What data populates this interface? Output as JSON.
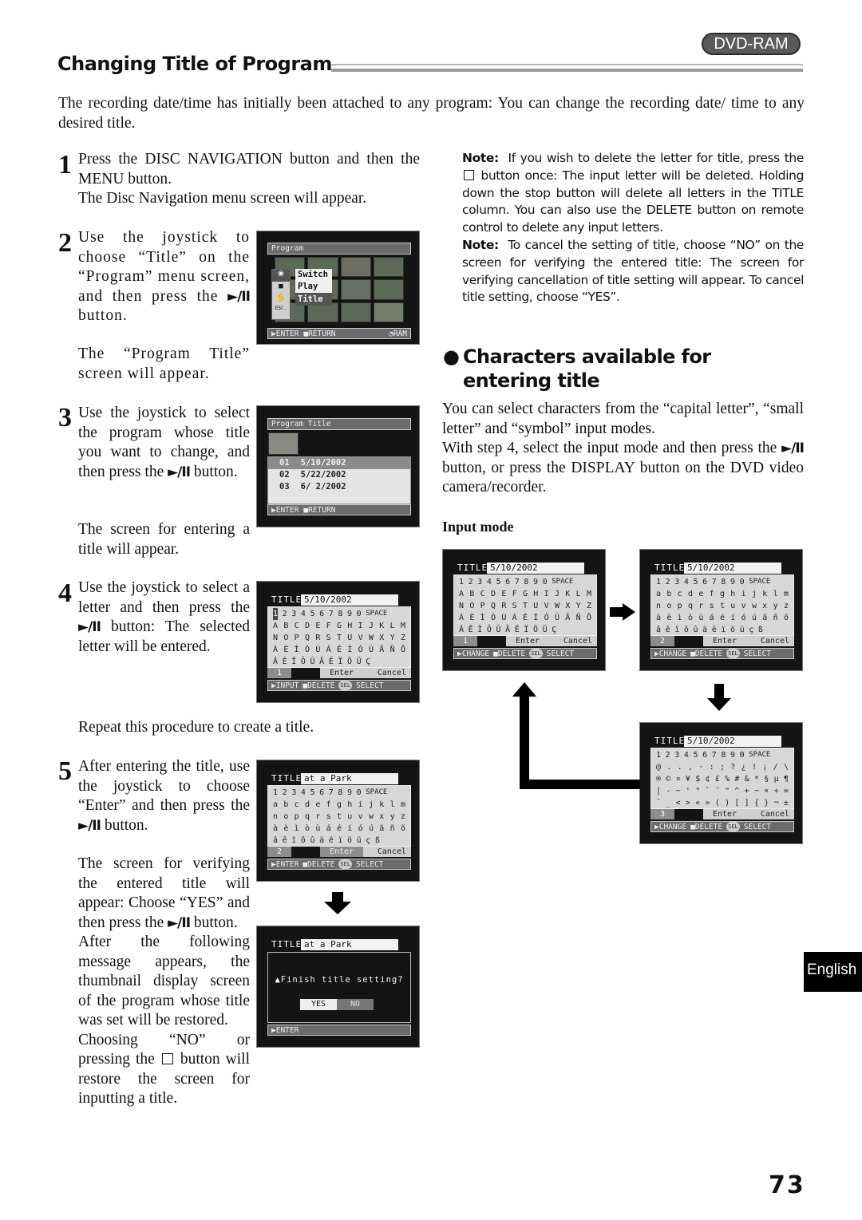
{
  "header": {
    "badge": "DVD-RAM",
    "section_title": "Changing Title of Program"
  },
  "intro": "The recording date/time has initially been attached to any program: You can change the recording date/ time to any desired title.",
  "icons": {
    "play_pause": "►/II",
    "stop_square": "□"
  },
  "steps": [
    {
      "num": "1",
      "text": "Press the DISC NAVIGATION button and then the MENU button.",
      "result": "The Disc Navigation menu screen will appear."
    },
    {
      "num": "2",
      "text_a": "Use the joystick to choose “Title” on the “Program” menu screen, and then press the",
      "text_b": "button.",
      "result": "The “Program Title” screen will appear."
    },
    {
      "num": "3",
      "text_a": "Use the joystick to select the program whose title you want to change, and then press the",
      "text_b": "button.",
      "result": "The screen for entering a title will appear."
    },
    {
      "num": "4",
      "text_a": "Use the joystick to select a letter and then press the",
      "text_b": "button: The selected letter will be entered.",
      "result": "Repeat this procedure to create a title."
    },
    {
      "num": "5",
      "text_a": "After entering the title, use the joystick to choose “Enter” and then press the",
      "text_b": "button.",
      "result_a": "The screen for verifying the entered title will appear: Choose “YES” and then press the",
      "result_b": "button.",
      "result2": "After the following message appears, the thumbnail display screen of the program whose title was set will be restored.",
      "result3_a": "Choosing “NO” or pressing the",
      "result3_b": "button will restore the screen for inputting a title."
    }
  ],
  "screens": {
    "program_menu": {
      "header": "Program",
      "menu_items": [
        "Switch",
        "Play",
        "Title"
      ],
      "selected": "Title",
      "side_icon_label": "ESC.",
      "footer_enter": "ENTER",
      "footer_return": "RETURN",
      "footer_media": "RAM"
    },
    "program_title": {
      "header": "Program Title",
      "rows": [
        {
          "no": "01",
          "date": "5/10/2002",
          "selected": true
        },
        {
          "no": "02",
          "date": "5/22/2002",
          "selected": false
        },
        {
          "no": "03",
          "date": "6/ 2/2002",
          "selected": false
        }
      ],
      "footer_enter": "ENTER",
      "footer_return": "RETURN"
    },
    "title_entry": {
      "label": "TITLE",
      "value": "5/10/2002",
      "mode_number": "1",
      "enter": "Enter",
      "cancel": "Cancel",
      "footer_a": "INPUT",
      "footer_b": "DELETE",
      "footer_sel": "SEL",
      "footer_c": "SELECT"
    },
    "title_enter_small": {
      "label": "TITLE",
      "value": "at a Park",
      "mode_number": "2",
      "enter": "Enter",
      "cancel": "Cancel",
      "footer_a": "ENTER",
      "footer_b": "DELETE",
      "footer_sel": "SEL",
      "footer_c": "SELECT"
    },
    "confirm": {
      "label": "TITLE",
      "value": "at a Park",
      "message": "Finish title setting?",
      "yes": "YES",
      "no": "NO",
      "footer": "ENTER"
    },
    "mode_footer": {
      "a": "CHANGE",
      "b": "DELETE",
      "sel": "SEL",
      "c": "SELECT"
    },
    "mode_title_value": "5/10/2002"
  },
  "char_sets": {
    "capital": [
      [
        "1",
        "2",
        "3",
        "4",
        "5",
        "6",
        "7",
        "8",
        "9",
        "0",
        "SPACE"
      ],
      [
        "A",
        "B",
        "C",
        "D",
        "E",
        "F",
        "G",
        "H",
        "I",
        "J",
        "K",
        "L",
        "M"
      ],
      [
        "N",
        "O",
        "P",
        "Q",
        "R",
        "S",
        "T",
        "U",
        "V",
        "W",
        "X",
        "Y",
        "Z"
      ],
      [
        "À",
        "È",
        "Ì",
        "Ò",
        "Ù",
        "Á",
        "É",
        "Í",
        "Ó",
        "Ú",
        "Ã",
        "Ñ",
        "Õ"
      ],
      [
        "Â",
        "Ê",
        "Î",
        "Ô",
        "Û",
        "Ä",
        "Ë",
        "Ï",
        "Ö",
        "Ü",
        "Ç"
      ]
    ],
    "small": [
      [
        "1",
        "2",
        "3",
        "4",
        "5",
        "6",
        "7",
        "8",
        "9",
        "0",
        "SPACE"
      ],
      [
        "a",
        "b",
        "c",
        "d",
        "e",
        "f",
        "g",
        "h",
        "i",
        "j",
        "k",
        "l",
        "m"
      ],
      [
        "n",
        "o",
        "p",
        "q",
        "r",
        "s",
        "t",
        "u",
        "v",
        "w",
        "x",
        "y",
        "z"
      ],
      [
        "à",
        "è",
        "ì",
        "ò",
        "ù",
        "á",
        "é",
        "í",
        "ó",
        "ú",
        "ã",
        "ñ",
        "õ"
      ],
      [
        "â",
        "ê",
        "î",
        "ô",
        "û",
        "ä",
        "ë",
        "ï",
        "ö",
        "ü",
        "ç",
        "ß"
      ]
    ],
    "symbol": [
      [
        "1",
        "2",
        "3",
        "4",
        "5",
        "6",
        "7",
        "8",
        "9",
        "0",
        "SPACE"
      ],
      [
        "@",
        ".",
        ".",
        ",",
        "·",
        ":",
        ";",
        "?",
        "¿",
        "!",
        "¡",
        "/",
        "\\"
      ],
      [
        "®",
        "©",
        "¤",
        "¥",
        "$",
        "¢",
        "£",
        "%",
        "#",
        "&",
        "*",
        "§",
        "µ",
        "¶"
      ],
      [
        "|",
        "-",
        "~",
        "'",
        "\"",
        "`",
        "´",
        "\"",
        "^",
        "+",
        "−",
        "×",
        "÷",
        "="
      ],
      [
        "¯",
        "_",
        "<",
        ">",
        "«",
        "»",
        "(",
        ")",
        "[",
        "]",
        "{",
        "}",
        "¬",
        "±"
      ]
    ]
  },
  "modes": [
    {
      "name": "capital letter",
      "number": "1"
    },
    {
      "name": "small letter",
      "number": "2"
    },
    {
      "name": "symbol",
      "number": "3"
    }
  ],
  "notes": [
    {
      "label": "Note:",
      "text_a": "If you wish to delete the letter for title, press the",
      "text_b": "button once: The input letter will be deleted. Holding down the stop button will delete all letters in the TITLE column. You can also use the DELETE button on remote control to delete any input letters."
    },
    {
      "label": "Note:",
      "text": "To cancel the setting of title, choose “NO” on the screen for verifying the entered title: The screen for verifying cancellation of title setting will appear. To cancel title setting, choose “YES”."
    }
  ],
  "chars_section": {
    "heading": "Characters available for entering title",
    "p1": "You can select characters from the “capital letter”, “small letter” and “symbol” input modes.",
    "p2_a": "With step 4, select the input mode and then press the",
    "p2_b": "button, or press the DISPLAY button on the DVD video camera/recorder.",
    "input_mode_label": "Input mode"
  },
  "side_tab": "English",
  "page_number": "73"
}
